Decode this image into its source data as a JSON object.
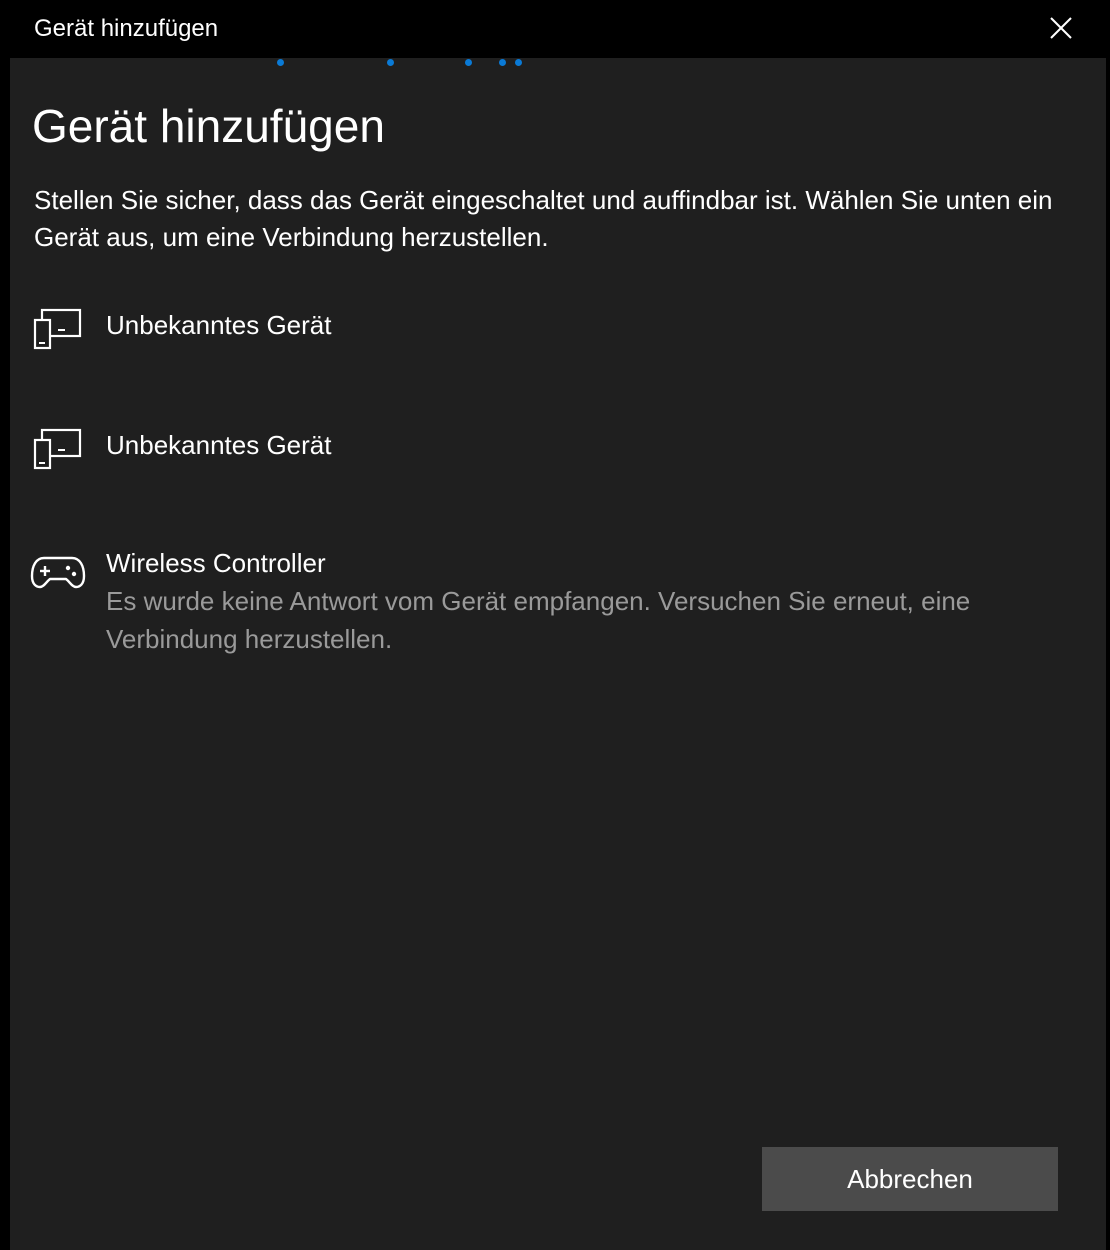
{
  "window": {
    "title": "Gerät hinzufügen"
  },
  "page": {
    "title": "Gerät hinzufügen",
    "instruction": "Stellen Sie sicher, dass das Gerät eingeschaltet und auffindbar ist. Wählen Sie unten ein Gerät aus, um eine Verbindung herzustellen."
  },
  "devices": [
    {
      "name": "Unbekanntes Gerät",
      "icon": "devices-icon"
    },
    {
      "name": "Unbekanntes Gerät",
      "icon": "devices-icon"
    },
    {
      "name": "Wireless Controller",
      "icon": "gamepad-icon",
      "status": "Es wurde keine Antwort vom Gerät empfangen. Versuchen Sie erneut, eine Verbindung herzustellen."
    }
  ],
  "footer": {
    "cancel_label": "Abbrechen"
  },
  "colors": {
    "background": "#1f1f1f",
    "titlebar": "#000000",
    "accent": "#0a7ad6",
    "button": "#4b4b4b",
    "secondary_text": "#9a9a9a"
  }
}
